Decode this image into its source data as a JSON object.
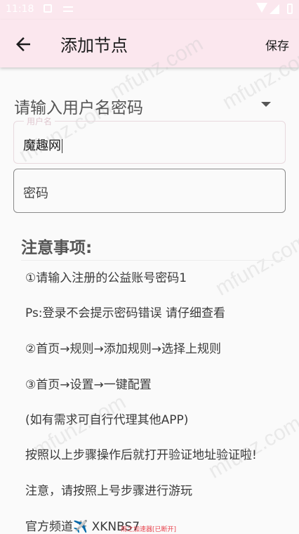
{
  "status_bar": {
    "time": "11:18"
  },
  "app_bar": {
    "title": "添加节点",
    "save_label": "保存",
    "back_icon": "arrow-left-icon"
  },
  "account_selector": {
    "label": "请输入用户名密码"
  },
  "form": {
    "username": {
      "label": "用户名",
      "value": "魔趣网"
    },
    "password": {
      "placeholder": "密码"
    }
  },
  "notes": {
    "title": "注意事项:",
    "items": [
      "①请输入注册的公益账号密码1",
      "Ps:登录不会提示密码错误 请仔细查看",
      "②首页→规则→添加规则→选择上规则",
      "③首页→设置→一键配置",
      "(如有需求可自行代理其他APP)",
      "按照以上步骤操作后就打开验证地址验证啦!",
      "注意，请按照上号步骤进行游玩"
    ],
    "channel_prefix": "官方频道",
    "channel_icon": "✈️",
    "channel_code": "XKNBS7"
  },
  "watermark": "mfunz.com",
  "bottom_caption": "雨之加速器[已断开]",
  "colors": {
    "app_bar_bg": "#fbe7ee",
    "page_bg": "#fafafa",
    "caption_red": "#e8454f"
  }
}
